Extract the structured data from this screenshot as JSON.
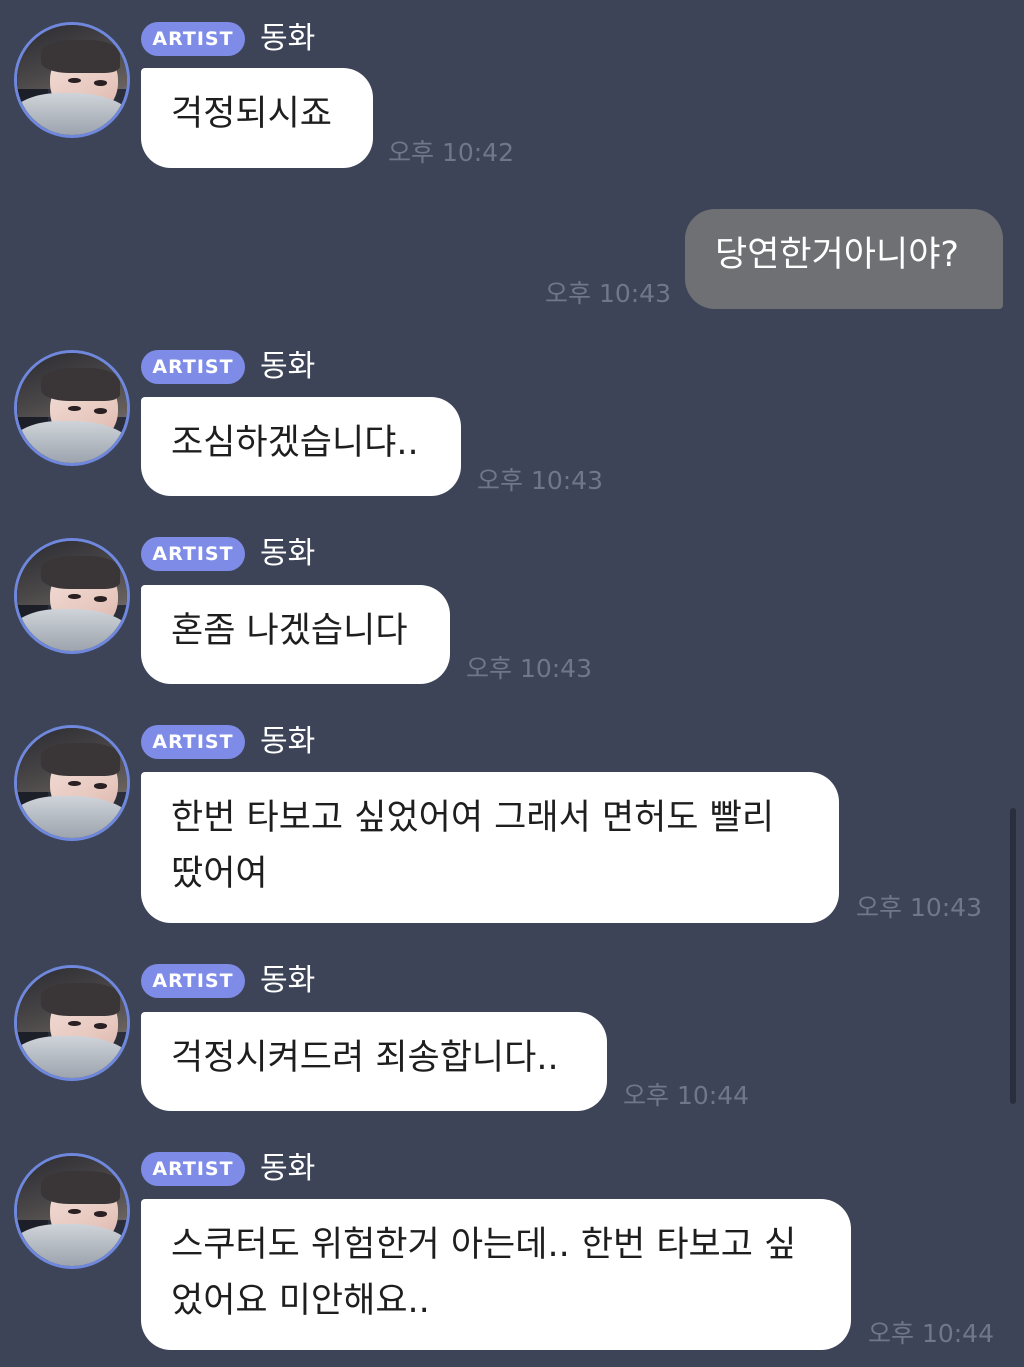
{
  "artist_badge": "ARTIST",
  "artist_name": "동화",
  "messages": [
    {
      "sender": "artist",
      "text": "걱정되시죠",
      "time": "오후 10:42"
    },
    {
      "sender": "me",
      "text": "당연한거아니야?",
      "time": "오후 10:43"
    },
    {
      "sender": "artist",
      "text": "조심하겠습니댜..",
      "time": "오후 10:43"
    },
    {
      "sender": "artist",
      "text": "혼좀 나겠습니다",
      "time": "오후 10:43"
    },
    {
      "sender": "artist",
      "text": "한번 타보고 싶었어여 그래서 면허도 빨리\n땄어여",
      "time": "오후 10:43"
    },
    {
      "sender": "artist",
      "text": "걱정시켜드려 죄송합니다..",
      "time": "오후 10:44"
    },
    {
      "sender": "artist",
      "text": "스쿠터도 위험한거 아는데.. 한번 타보고 싶\n었어요 미안해요..",
      "time": "오후 10:44"
    }
  ],
  "colors": {
    "background": "#3d4458",
    "badge": "#7e8ce8",
    "incoming_bubble": "#ffffff",
    "outgoing_bubble": "#6f7074",
    "timestamp": "#70778a",
    "avatar_ring": "#6f88dd"
  }
}
